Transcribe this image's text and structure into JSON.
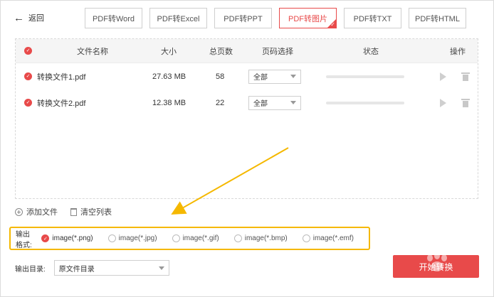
{
  "header": {
    "back_label": "返回",
    "tabs": [
      {
        "label": "PDF转Word",
        "active": false
      },
      {
        "label": "PDF转Excel",
        "active": false
      },
      {
        "label": "PDF转PPT",
        "active": false
      },
      {
        "label": "PDF转图片",
        "active": true
      },
      {
        "label": "PDF转TXT",
        "active": false
      },
      {
        "label": "PDF转HTML",
        "active": false
      }
    ]
  },
  "table": {
    "columns": {
      "name": "文件名称",
      "size": "大小",
      "pages": "总页数",
      "page_select": "页码选择",
      "status": "状态",
      "actions": "操作"
    },
    "rows": [
      {
        "name": "转换文件1.pdf",
        "size": "27.63 MB",
        "pages": "58",
        "page_select": "全部",
        "progress": 0
      },
      {
        "name": "转换文件2.pdf",
        "size": "12.38 MB",
        "pages": "22",
        "page_select": "全部",
        "progress": 0
      }
    ]
  },
  "actions": {
    "add_file": "添加文件",
    "clear_list": "清空列表"
  },
  "output_format": {
    "label": "输出格式:",
    "options": [
      {
        "label": "image(*.png)",
        "selected": true
      },
      {
        "label": "image(*.jpg)",
        "selected": false
      },
      {
        "label": "image(*.gif)",
        "selected": false
      },
      {
        "label": "image(*.bmp)",
        "selected": false
      },
      {
        "label": "image(*.emf)",
        "selected": false
      }
    ]
  },
  "output_dir": {
    "label": "输出目录:",
    "value": "原文件目录"
  },
  "start_button": {
    "label": "开始转换"
  },
  "colors": {
    "accent": "#e84a4a",
    "highlight": "#f5b800"
  }
}
